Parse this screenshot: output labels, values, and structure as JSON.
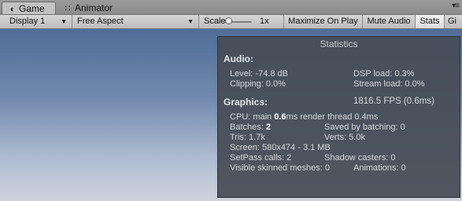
{
  "tabs": [
    {
      "label": "Game",
      "icon": "game-icon",
      "active": true
    },
    {
      "label": "Animator",
      "icon": "animator-icon",
      "active": false
    }
  ],
  "toolbar": {
    "display": "Display 1",
    "aspect": "Free Aspect",
    "scale_label": "Scale",
    "scale_value": "1x",
    "scale_level": 0.05,
    "maximize_on_play": "Maximize On Play",
    "mute_audio": "Mute Audio",
    "stats": "Stats",
    "gizmos": "Gi"
  },
  "statistics": {
    "title": "Statistics",
    "audio": {
      "heading": "Audio:",
      "level": "Level: -74.8 dB",
      "clipping": "Clipping: 0.0%",
      "dsp_load": "DSP load: 0.3%",
      "stream_load": "Stream load: 0.0%"
    },
    "graphics": {
      "heading": "Graphics:",
      "fps": "1816.5 FPS (0.6ms)",
      "cpu_prefix": "CPU: main ",
      "cpu_main": "0.6",
      "cpu_suffix": "ms  render thread 0.4ms",
      "batches_prefix": "Batches: ",
      "batches": "2",
      "saved_by_batching": "Saved by batching: 0",
      "tris": "Tris: 1.7k",
      "verts": "Verts: 5.0k",
      "screen": "Screen: 580x474 - 3.1 MB",
      "setpass": "SetPass calls: 2",
      "shadow_casters": "Shadow casters: 0",
      "skinned_meshes": "Visible skinned meshes: 0",
      "animations": "Animations: 0"
    }
  }
}
